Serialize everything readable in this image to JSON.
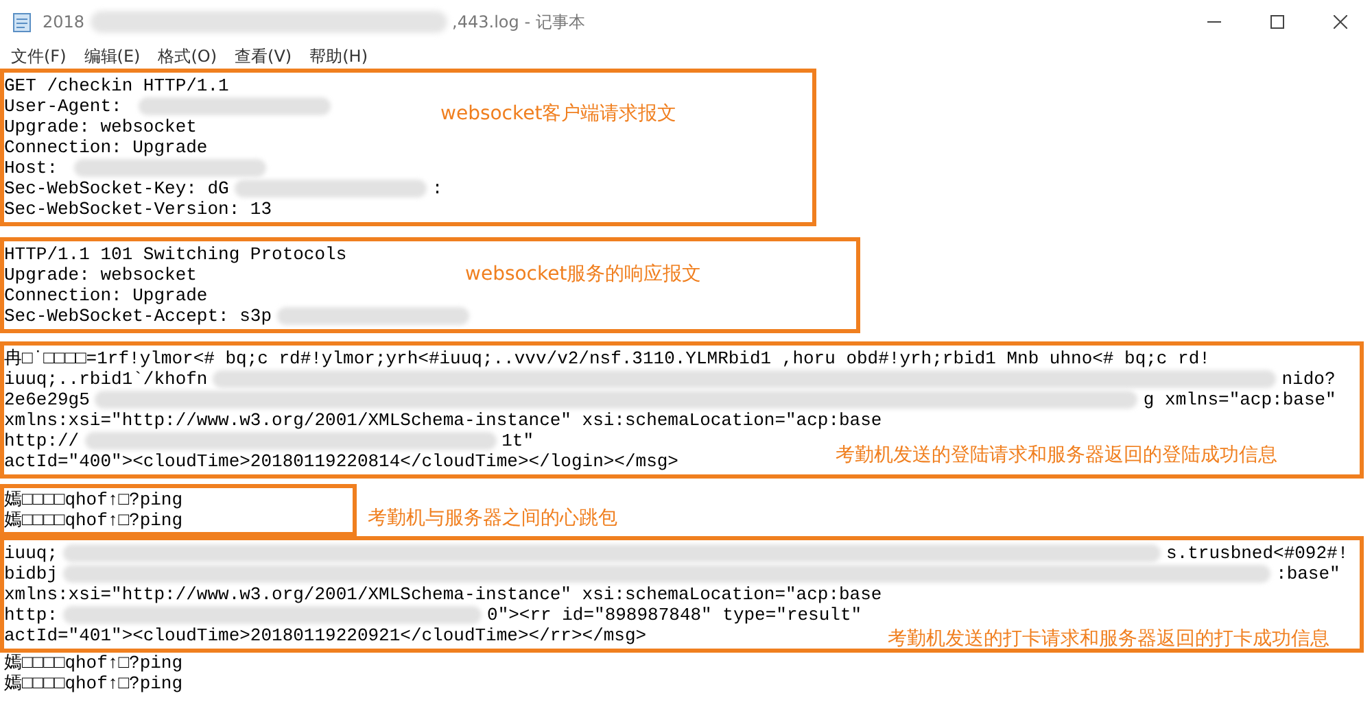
{
  "window": {
    "title_start": "2018",
    "title_end": ",443.log - 记事本"
  },
  "menu": [
    "文件(F)",
    "编辑(E)",
    "格式(O)",
    "查看(V)",
    "帮助(H)"
  ],
  "sections": [
    {
      "kind": "box",
      "label": "websocket客户端请求报文",
      "lines": [
        {
          "text": "GET /checkin HTTP/1.1"
        },
        {
          "text": "User-Agent: ",
          "redacted": true
        },
        {
          "text": "Upgrade: websocket"
        },
        {
          "text": "Connection: Upgrade"
        },
        {
          "text": "Host: ",
          "redacted": true
        },
        {
          "text": "Sec-WebSocket-Key: dG",
          "redacted": true,
          "tail": ":"
        },
        {
          "text": "Sec-WebSocket-Version: 13"
        }
      ]
    },
    {
      "kind": "box",
      "label": "websocket服务的响应报文",
      "lines": [
        {
          "text": "HTTP/1.1 101 Switching Protocols"
        },
        {
          "text": "Upgrade: websocket"
        },
        {
          "text": "Connection: Upgrade"
        },
        {
          "text": "Sec-WebSocket-Accept: s3p",
          "redacted": true
        }
      ]
    },
    {
      "kind": "box",
      "label": "考勤机发送的登陆请求和服务器返回的登陆成功信息",
      "lines": [
        {
          "text": "冉□˙□□□□=1rf!ylmor<# bq;c rd#!ylmor;yrh<#iuuq;..vvv/v2/nsf.3110.YLMRbid1 ,horu obd#!yrh;rbid1 Mnb uhno<# bq;c rd!"
        },
        {
          "text": "iuuq;..rbid1`/khofn",
          "redacted": true,
          "tail": "nido?"
        },
        {
          "text": "2e6e29g5",
          "redacted": true,
          "tail": "g xmlns=\"acp:base\""
        },
        {
          "text": "xmlns:xsi=\"http://www.w3.org/2001/XMLSchema-instance\" xsi:schemaLocation=\"acp:base"
        },
        {
          "text": "http://",
          "redacted": true,
          "tail": "1t\""
        },
        {
          "text": "actId=\"400\"><cloudTime>20180119220814</cloudTime></login></msg>"
        }
      ]
    },
    {
      "kind": "note",
      "label": "考勤机与服务器之间的心跳包",
      "lines": [
        {
          "text": "嫣□□□□qhof↑□?ping"
        },
        {
          "text": "嫣□□□□qhof↑□?ping"
        }
      ]
    },
    {
      "kind": "box",
      "label": "考勤机发送的打卡请求和服务器返回的打卡成功信息",
      "lines": [
        {
          "text": "iuuq;",
          "redacted": true,
          "tail": "s.trusbned<#092#!"
        },
        {
          "text": "bidbj",
          "redacted": true,
          "tail": ":base\""
        },
        {
          "text": "xmlns:xsi=\"http://www.w3.org/2001/XMLSchema-instance\" xsi:schemaLocation=\"acp:base"
        },
        {
          "text": "http:",
          "redacted": true,
          "tail": "0\"><rr id=\"898987848\" type=\"result\""
        },
        {
          "text": "actId=\"401\"><cloudTime>20180119220921</cloudTime></rr></msg>"
        }
      ]
    },
    {
      "kind": "plain",
      "lines": [
        {
          "text": "嫣□□□□qhof↑□?ping"
        },
        {
          "text": "嫣□□□□qhof↑□?ping"
        }
      ]
    }
  ]
}
